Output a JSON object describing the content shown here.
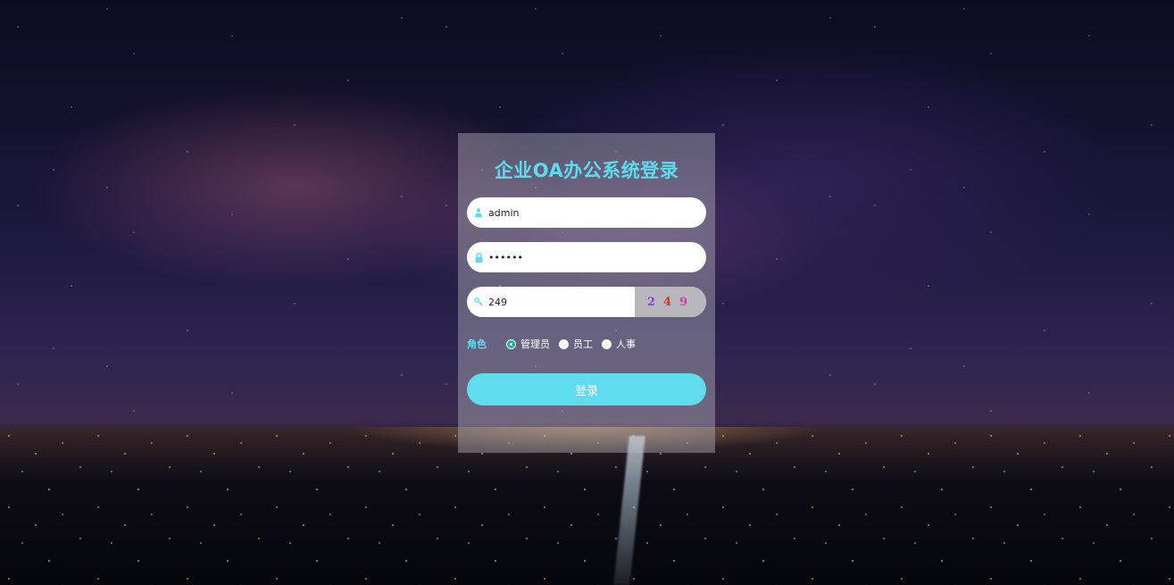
{
  "login": {
    "title": "企业OA办公系统登录",
    "username": {
      "value": "admin",
      "icon": "user-icon"
    },
    "password": {
      "value": "••••••",
      "icon": "lock-icon"
    },
    "captcha": {
      "value": "249",
      "icon": "key-icon",
      "image_chars": [
        "2",
        "4",
        "9"
      ],
      "image_colors": [
        "#8a3fd1",
        "#e0301e",
        "#d63fa0"
      ]
    },
    "role": {
      "label": "角色",
      "options": [
        "管理员",
        "员工",
        "人事"
      ],
      "selected": "管理员"
    },
    "submit_label": "登录"
  },
  "colors": {
    "accent": "#5ddcf0",
    "button": "#5fdcee",
    "radio_checked": "#1ab394"
  }
}
